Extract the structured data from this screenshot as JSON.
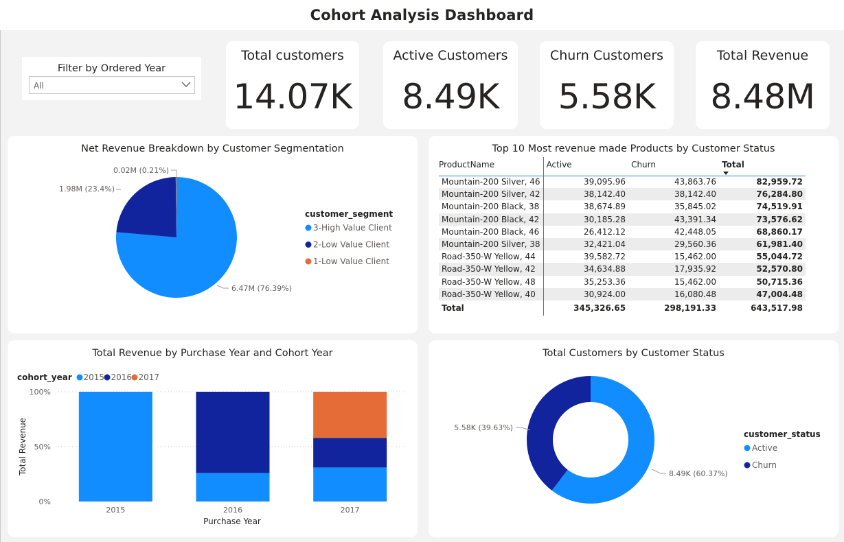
{
  "title": "Cohort Analysis Dashboard",
  "filter": {
    "title": "Filter by Ordered Year",
    "value": "All",
    "icon": "chevron-down-icon"
  },
  "kpis": [
    {
      "label": "Total customers",
      "value": "14.07K"
    },
    {
      "label": "Active Customers",
      "value": "8.49K"
    },
    {
      "label": "Churn Customers",
      "value": "5.58K"
    },
    {
      "label": "Total Revenue",
      "value": "8.48M"
    }
  ],
  "colors": {
    "high_value": "#118dff",
    "low_value_2": "#12239e",
    "low_value_1": "#e66c37",
    "table_accent": "#2d7dd2",
    "canvas": "#f3f3f3"
  },
  "pie": {
    "title": "Net Revenue Breakdown by Customer Segmentation",
    "legend_title": "customer_segment",
    "slices": [
      {
        "name": "3-High Value Client",
        "value": 6.47,
        "percent": 76.39,
        "label": "6.47M (76.39%)",
        "color": "#118dff"
      },
      {
        "name": "2-Low Value Client",
        "value": 1.98,
        "percent": 23.4,
        "label": "1.98M (23.4%)",
        "color": "#12239e"
      },
      {
        "name": "1-Low Value Client",
        "value": 0.02,
        "percent": 0.21,
        "label": "0.02M (0.21%)",
        "color": "#e66c37"
      }
    ]
  },
  "table": {
    "title": "Top 10 Most revenue made Products by Customer Status",
    "columns": [
      "ProductName",
      "Active",
      "Churn",
      "Total"
    ],
    "rows": [
      [
        "Mountain-200 Silver, 46",
        "39,095.96",
        "43,863.76",
        "82,959.72"
      ],
      [
        "Mountain-200 Silver, 42",
        "38,142.40",
        "38,142.40",
        "76,284.80"
      ],
      [
        "Mountain-200 Black, 38",
        "38,674.89",
        "35,845.02",
        "74,519.91"
      ],
      [
        "Mountain-200 Black, 42",
        "30,185.28",
        "43,391.34",
        "73,576.62"
      ],
      [
        "Mountain-200 Black, 46",
        "26,412.12",
        "42,448.05",
        "68,860.17"
      ],
      [
        "Mountain-200 Silver, 38",
        "32,421.04",
        "29,560.36",
        "61,981.40"
      ],
      [
        "Road-350-W Yellow, 44",
        "39,582.72",
        "15,462.00",
        "55,044.72"
      ],
      [
        "Road-350-W Yellow, 42",
        "34,634.88",
        "17,935.92",
        "52,570.80"
      ],
      [
        "Road-350-W Yellow, 48",
        "35,253.36",
        "15,462.00",
        "50,715.36"
      ],
      [
        "Road-350-W Yellow, 40",
        "30,924.00",
        "16,080.48",
        "47,004.48"
      ]
    ],
    "totals": [
      "Total",
      "345,326.65",
      "298,191.33",
      "643,517.98"
    ]
  },
  "chart_data": [
    {
      "type": "bar",
      "stacked": "100%",
      "title": "Total Revenue by Purchase Year and Cohort Year",
      "legend_title": "cohort_year",
      "legend_position": "top-left",
      "xlabel": "Purchase Year",
      "ylabel": "Total Revenue",
      "categories": [
        "2015",
        "2016",
        "2017"
      ],
      "yticks": [
        "0%",
        "50%",
        "100%"
      ],
      "ylim": [
        0,
        100
      ],
      "grid": true,
      "series": [
        {
          "name": "2015",
          "color": "#118dff",
          "values": [
            100,
            26,
            31
          ]
        },
        {
          "name": "2016",
          "color": "#12239e",
          "values": [
            0,
            74,
            27
          ]
        },
        {
          "name": "2017",
          "color": "#e66c37",
          "values": [
            0,
            0,
            42
          ]
        }
      ]
    },
    {
      "type": "pie",
      "variant": "donut",
      "title": "Total Customers by Customer Status",
      "legend_title": "customer_status",
      "legend_position": "right",
      "slices": [
        {
          "name": "Active",
          "value": 8.49,
          "percent": 60.37,
          "label": "8.49K (60.37%)",
          "color": "#118dff"
        },
        {
          "name": "Churn",
          "value": 5.58,
          "percent": 39.63,
          "label": "5.58K (39.63%)",
          "color": "#12239e"
        }
      ]
    }
  ]
}
